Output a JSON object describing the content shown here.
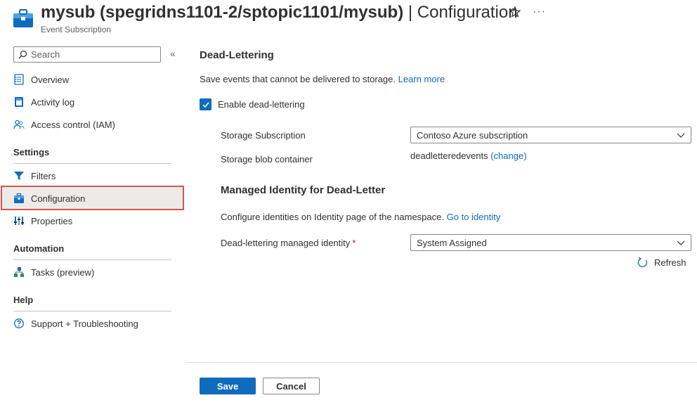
{
  "header": {
    "resource_name": "mysub (spegridns1101-2/sptopic1101/mysub)",
    "separator": "|",
    "page_title": "Configuration",
    "subtitle": "Event Subscription",
    "icon": "event-subscription-icon",
    "favorite_icon": "star-icon",
    "more_label": "···"
  },
  "sidebar": {
    "search_placeholder": "Search",
    "collapse_label": "«",
    "items_top": [
      {
        "label": "Overview",
        "icon": "overview-icon"
      },
      {
        "label": "Activity log",
        "icon": "activity-log-icon"
      },
      {
        "label": "Access control (IAM)",
        "icon": "iam-icon"
      }
    ],
    "sections": [
      {
        "title": "Settings",
        "items": [
          {
            "label": "Filters",
            "icon": "filter-icon"
          },
          {
            "label": "Configuration",
            "icon": "configuration-icon",
            "active": true
          },
          {
            "label": "Properties",
            "icon": "properties-icon"
          }
        ]
      },
      {
        "title": "Automation",
        "items": [
          {
            "label": "Tasks (preview)",
            "icon": "tasks-icon"
          }
        ]
      },
      {
        "title": "Help",
        "items": [
          {
            "label": "Support + Troubleshooting",
            "icon": "support-icon"
          }
        ]
      }
    ]
  },
  "main": {
    "heading": "Dead-Lettering",
    "description": "Save events that cannot be delivered to storage.",
    "learn_more": "Learn more",
    "enable_label": "Enable dead-lettering",
    "enable_checked": true,
    "storage_subscription_label": "Storage Subscription",
    "storage_subscription_value": "Contoso Azure subscription",
    "blob_container_label": "Storage blob container",
    "blob_container_value": "deadletteredevents",
    "change_link": "(change)",
    "identity_heading": "Managed Identity for Dead-Letter",
    "identity_desc": "Configure identities on Identity page of the namespace.",
    "identity_link": "Go to identity",
    "managed_identity_label": "Dead-lettering managed identity",
    "required_marker": "*",
    "managed_identity_value": "System Assigned",
    "refresh_label": "Refresh"
  },
  "footer": {
    "save_label": "Save",
    "cancel_label": "Cancel"
  },
  "colors": {
    "accent": "#0f6cbd",
    "active_highlight_border": "#d9534f",
    "active_bg": "#edebe9",
    "required": "#a4262c"
  }
}
